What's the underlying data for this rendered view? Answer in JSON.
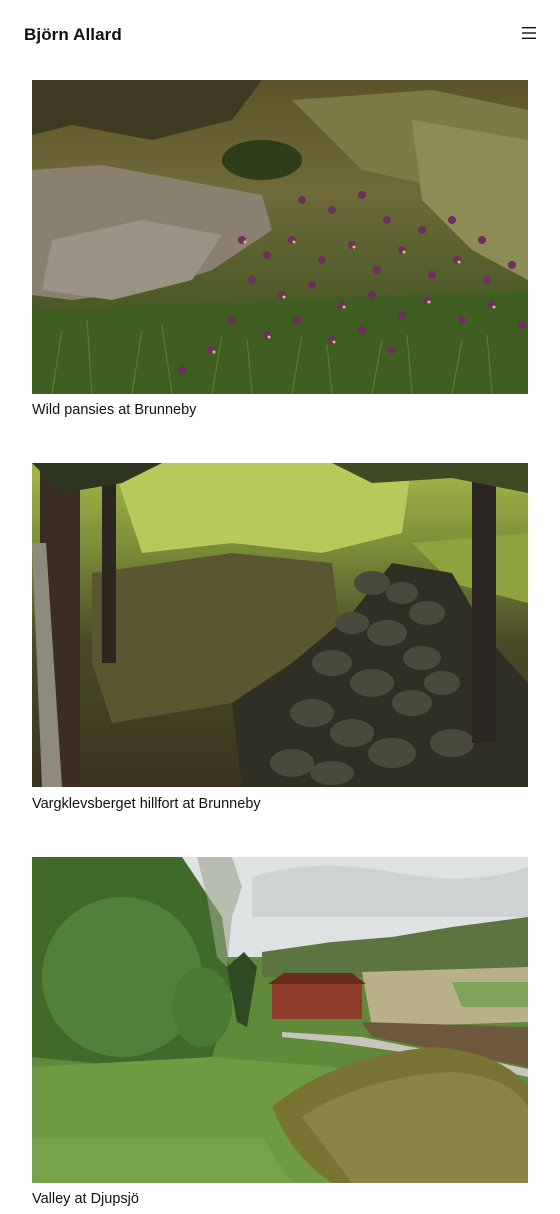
{
  "header": {
    "site_title": "Björn Allard",
    "menu_icon": "hamburger-menu-icon"
  },
  "gallery": [
    {
      "caption": "Wild pansies at Brunneby"
    },
    {
      "caption": "Vargklevsberget hillfort at Brunneby"
    },
    {
      "caption": "Valley at Djupsjö"
    }
  ],
  "colors": {
    "background": "#ffffff",
    "text": "#111111"
  }
}
